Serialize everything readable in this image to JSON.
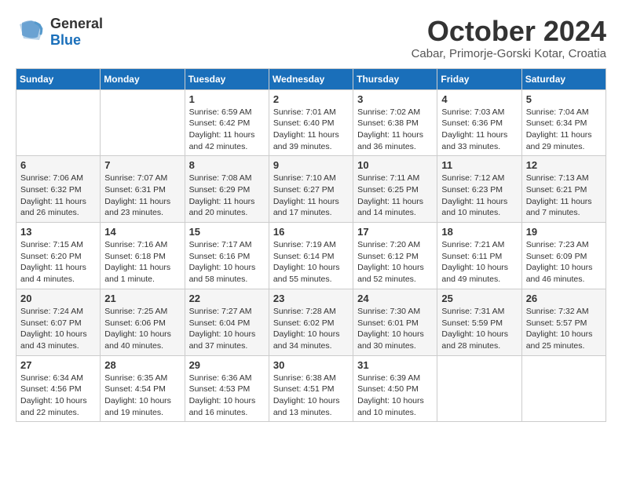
{
  "header": {
    "logo_general": "General",
    "logo_blue": "Blue",
    "month_title": "October 2024",
    "location": "Cabar, Primorje-Gorski Kotar, Croatia"
  },
  "weekdays": [
    "Sunday",
    "Monday",
    "Tuesday",
    "Wednesday",
    "Thursday",
    "Friday",
    "Saturday"
  ],
  "weeks": [
    [
      {
        "day": "",
        "sunrise": "",
        "sunset": "",
        "daylight": ""
      },
      {
        "day": "",
        "sunrise": "",
        "sunset": "",
        "daylight": ""
      },
      {
        "day": "1",
        "sunrise": "Sunrise: 6:59 AM",
        "sunset": "Sunset: 6:42 PM",
        "daylight": "Daylight: 11 hours and 42 minutes."
      },
      {
        "day": "2",
        "sunrise": "Sunrise: 7:01 AM",
        "sunset": "Sunset: 6:40 PM",
        "daylight": "Daylight: 11 hours and 39 minutes."
      },
      {
        "day": "3",
        "sunrise": "Sunrise: 7:02 AM",
        "sunset": "Sunset: 6:38 PM",
        "daylight": "Daylight: 11 hours and 36 minutes."
      },
      {
        "day": "4",
        "sunrise": "Sunrise: 7:03 AM",
        "sunset": "Sunset: 6:36 PM",
        "daylight": "Daylight: 11 hours and 33 minutes."
      },
      {
        "day": "5",
        "sunrise": "Sunrise: 7:04 AM",
        "sunset": "Sunset: 6:34 PM",
        "daylight": "Daylight: 11 hours and 29 minutes."
      }
    ],
    [
      {
        "day": "6",
        "sunrise": "Sunrise: 7:06 AM",
        "sunset": "Sunset: 6:32 PM",
        "daylight": "Daylight: 11 hours and 26 minutes."
      },
      {
        "day": "7",
        "sunrise": "Sunrise: 7:07 AM",
        "sunset": "Sunset: 6:31 PM",
        "daylight": "Daylight: 11 hours and 23 minutes."
      },
      {
        "day": "8",
        "sunrise": "Sunrise: 7:08 AM",
        "sunset": "Sunset: 6:29 PM",
        "daylight": "Daylight: 11 hours and 20 minutes."
      },
      {
        "day": "9",
        "sunrise": "Sunrise: 7:10 AM",
        "sunset": "Sunset: 6:27 PM",
        "daylight": "Daylight: 11 hours and 17 minutes."
      },
      {
        "day": "10",
        "sunrise": "Sunrise: 7:11 AM",
        "sunset": "Sunset: 6:25 PM",
        "daylight": "Daylight: 11 hours and 14 minutes."
      },
      {
        "day": "11",
        "sunrise": "Sunrise: 7:12 AM",
        "sunset": "Sunset: 6:23 PM",
        "daylight": "Daylight: 11 hours and 10 minutes."
      },
      {
        "day": "12",
        "sunrise": "Sunrise: 7:13 AM",
        "sunset": "Sunset: 6:21 PM",
        "daylight": "Daylight: 11 hours and 7 minutes."
      }
    ],
    [
      {
        "day": "13",
        "sunrise": "Sunrise: 7:15 AM",
        "sunset": "Sunset: 6:20 PM",
        "daylight": "Daylight: 11 hours and 4 minutes."
      },
      {
        "day": "14",
        "sunrise": "Sunrise: 7:16 AM",
        "sunset": "Sunset: 6:18 PM",
        "daylight": "Daylight: 11 hours and 1 minute."
      },
      {
        "day": "15",
        "sunrise": "Sunrise: 7:17 AM",
        "sunset": "Sunset: 6:16 PM",
        "daylight": "Daylight: 10 hours and 58 minutes."
      },
      {
        "day": "16",
        "sunrise": "Sunrise: 7:19 AM",
        "sunset": "Sunset: 6:14 PM",
        "daylight": "Daylight: 10 hours and 55 minutes."
      },
      {
        "day": "17",
        "sunrise": "Sunrise: 7:20 AM",
        "sunset": "Sunset: 6:12 PM",
        "daylight": "Daylight: 10 hours and 52 minutes."
      },
      {
        "day": "18",
        "sunrise": "Sunrise: 7:21 AM",
        "sunset": "Sunset: 6:11 PM",
        "daylight": "Daylight: 10 hours and 49 minutes."
      },
      {
        "day": "19",
        "sunrise": "Sunrise: 7:23 AM",
        "sunset": "Sunset: 6:09 PM",
        "daylight": "Daylight: 10 hours and 46 minutes."
      }
    ],
    [
      {
        "day": "20",
        "sunrise": "Sunrise: 7:24 AM",
        "sunset": "Sunset: 6:07 PM",
        "daylight": "Daylight: 10 hours and 43 minutes."
      },
      {
        "day": "21",
        "sunrise": "Sunrise: 7:25 AM",
        "sunset": "Sunset: 6:06 PM",
        "daylight": "Daylight: 10 hours and 40 minutes."
      },
      {
        "day": "22",
        "sunrise": "Sunrise: 7:27 AM",
        "sunset": "Sunset: 6:04 PM",
        "daylight": "Daylight: 10 hours and 37 minutes."
      },
      {
        "day": "23",
        "sunrise": "Sunrise: 7:28 AM",
        "sunset": "Sunset: 6:02 PM",
        "daylight": "Daylight: 10 hours and 34 minutes."
      },
      {
        "day": "24",
        "sunrise": "Sunrise: 7:30 AM",
        "sunset": "Sunset: 6:01 PM",
        "daylight": "Daylight: 10 hours and 30 minutes."
      },
      {
        "day": "25",
        "sunrise": "Sunrise: 7:31 AM",
        "sunset": "Sunset: 5:59 PM",
        "daylight": "Daylight: 10 hours and 28 minutes."
      },
      {
        "day": "26",
        "sunrise": "Sunrise: 7:32 AM",
        "sunset": "Sunset: 5:57 PM",
        "daylight": "Daylight: 10 hours and 25 minutes."
      }
    ],
    [
      {
        "day": "27",
        "sunrise": "Sunrise: 6:34 AM",
        "sunset": "Sunset: 4:56 PM",
        "daylight": "Daylight: 10 hours and 22 minutes."
      },
      {
        "day": "28",
        "sunrise": "Sunrise: 6:35 AM",
        "sunset": "Sunset: 4:54 PM",
        "daylight": "Daylight: 10 hours and 19 minutes."
      },
      {
        "day": "29",
        "sunrise": "Sunrise: 6:36 AM",
        "sunset": "Sunset: 4:53 PM",
        "daylight": "Daylight: 10 hours and 16 minutes."
      },
      {
        "day": "30",
        "sunrise": "Sunrise: 6:38 AM",
        "sunset": "Sunset: 4:51 PM",
        "daylight": "Daylight: 10 hours and 13 minutes."
      },
      {
        "day": "31",
        "sunrise": "Sunrise: 6:39 AM",
        "sunset": "Sunset: 4:50 PM",
        "daylight": "Daylight: 10 hours and 10 minutes."
      },
      {
        "day": "",
        "sunrise": "",
        "sunset": "",
        "daylight": ""
      },
      {
        "day": "",
        "sunrise": "",
        "sunset": "",
        "daylight": ""
      }
    ]
  ]
}
